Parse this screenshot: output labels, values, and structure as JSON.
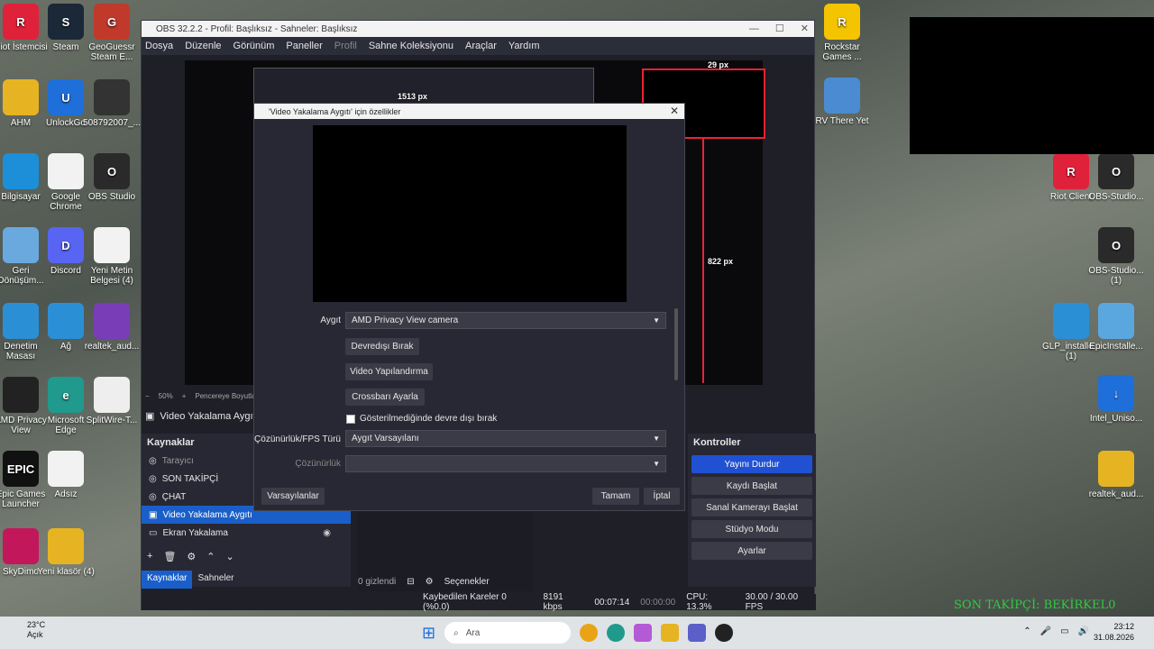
{
  "desktop": {
    "left_icons": [
      {
        "label": "Riot İstemcisi",
        "color": "#e0213a",
        "glyph": "R"
      },
      {
        "label": "Steam",
        "color": "#1b2838",
        "glyph": "S"
      },
      {
        "label": "GeoGuessr Steam E...",
        "color": "#c0392b",
        "glyph": "G"
      },
      {
        "label": "AHM",
        "color": "#e6b422",
        "glyph": ""
      },
      {
        "label": "UnlockGo",
        "color": "#1e6fd9",
        "glyph": "U"
      },
      {
        "label": "508792007_...",
        "color": "#333",
        "glyph": ""
      },
      {
        "label": "Bilgisayar",
        "color": "#1d8fd8",
        "glyph": ""
      },
      {
        "label": "Google Chrome",
        "color": "#f2f2f2",
        "glyph": ""
      },
      {
        "label": "OBS Studio",
        "color": "#2a2a2a",
        "glyph": "O"
      },
      {
        "label": "Geri Dönüşüm...",
        "color": "#6aa9de",
        "glyph": ""
      },
      {
        "label": "Discord",
        "color": "#5865f2",
        "glyph": "D"
      },
      {
        "label": "Yeni Metin Belgesi (4)",
        "color": "#f2f2f2",
        "glyph": ""
      },
      {
        "label": "Denetim Masası",
        "color": "#2b8fd6",
        "glyph": ""
      },
      {
        "label": "Ağ",
        "color": "#2b8fd6",
        "glyph": ""
      },
      {
        "label": "realtek_aud...",
        "color": "#7a3db8",
        "glyph": ""
      },
      {
        "label": "AMD Privacy View",
        "color": "#222",
        "glyph": ""
      },
      {
        "label": "Microsoft Edge",
        "color": "#1f9a8c",
        "glyph": "e"
      },
      {
        "label": "SplitWire-T...",
        "color": "#eee",
        "glyph": ""
      },
      {
        "label": "Epic Games Launcher",
        "color": "#111",
        "glyph": "EPIC"
      },
      {
        "label": "Adsız",
        "color": "#f2f2f2",
        "glyph": ""
      },
      {
        "label": "SkyDimo",
        "color": "#c2185b",
        "glyph": ""
      },
      {
        "label": "Yeni klasör (4)",
        "color": "#e6b422",
        "glyph": ""
      }
    ],
    "right_icons": [
      {
        "label": "Rockstar Games ...",
        "color": "#f5c400",
        "glyph": "R"
      },
      {
        "label": "RV There Yet",
        "color": "#4b8bd1",
        "glyph": ""
      },
      {
        "label": "Riot Client",
        "color": "#e0213a",
        "glyph": "R"
      },
      {
        "label": "OBS-Studio...",
        "color": "#2a2a2a",
        "glyph": "O"
      },
      {
        "label": "OBS-Studio... (1)",
        "color": "#2a2a2a",
        "glyph": "O"
      },
      {
        "label": "GLP_installe... (1)",
        "color": "#2b8fd6",
        "glyph": ""
      },
      {
        "label": "EpicInstalle...",
        "color": "#5aa7e0",
        "glyph": ""
      },
      {
        "label": "Intel_Uniso...",
        "color": "#1e6fd9",
        "glyph": "↓"
      },
      {
        "label": "realtek_aud...",
        "color": "#e6b422",
        "glyph": ""
      }
    ],
    "overlay_text": "SON TAKİPÇİ: BEKİRKEL0"
  },
  "obs": {
    "title": "OBS 32.2.2 - Profil: Başlıksız - Sahneler: Başlıksız",
    "menu": [
      "Dosya",
      "Düzenle",
      "Görünüm",
      "Paneller",
      "Profil",
      "Sahne Koleksiyonu",
      "Araçlar",
      "Yardım"
    ],
    "preview_labels": {
      "top": "29 px",
      "right": "822 px",
      "inner": "1513 px"
    },
    "zoom": "50%",
    "zoom_mode": "Pencereye Boyutland...",
    "selected_source_bar": "Video Yakalama Aygıtı",
    "sources_title": "Kaynaklar",
    "sources": [
      {
        "label": "Tarayıcı",
        "selected": false
      },
      {
        "label": "SON TAKİPÇİ",
        "selected": false
      },
      {
        "label": "ÇHAT",
        "selected": false
      },
      {
        "label": "Video Yakalama Aygıtı",
        "selected": true
      },
      {
        "label": "Ekran Yakalama",
        "selected": false
      }
    ],
    "bottom_tabs": [
      "Kaynaklar",
      "Sahneler"
    ],
    "mixer": {
      "hidden": "0 gizlendi",
      "options": "Seçenekler"
    },
    "controls_title": "Kontroller",
    "controls": [
      "Yayını Durdur",
      "Kaydı Başlat",
      "Sanal Kamerayı Başlat",
      "Stüdyo Modu",
      "Ayarlar"
    ],
    "status": {
      "dropped": "Kaybedilen Kareler 0 (%0.0)",
      "bitrate": "8191 kbps",
      "stream_time": "00:07:14",
      "rec_time": "00:00:00",
      "cpu": "CPU: 13.3%",
      "fps": "30.00 / 30.00 FPS"
    }
  },
  "dialog": {
    "title": "'Video Yakalama Aygıtı' için özellikler",
    "device_label": "Aygıt",
    "device_value": "AMD Privacy View camera",
    "buttons": [
      "Devredışı Bırak",
      "Video Yapılandırma",
      "Crossbarı Ayarla"
    ],
    "checkbox_label": "Gösterilmediğinde devre dışı bırak",
    "res_type_label": "Çözünürlük/FPS Türü",
    "res_type_value": "Aygıt Varsayılanı",
    "res_label": "Çözünürlük",
    "res_value": "",
    "defaults": "Varsayılanlar",
    "ok": "Tamam",
    "cancel": "İptal"
  },
  "taskbar": {
    "temp": "23°C",
    "weather": "Açık",
    "search": "Ara",
    "time": "23:12",
    "date": "31.08.2026"
  }
}
